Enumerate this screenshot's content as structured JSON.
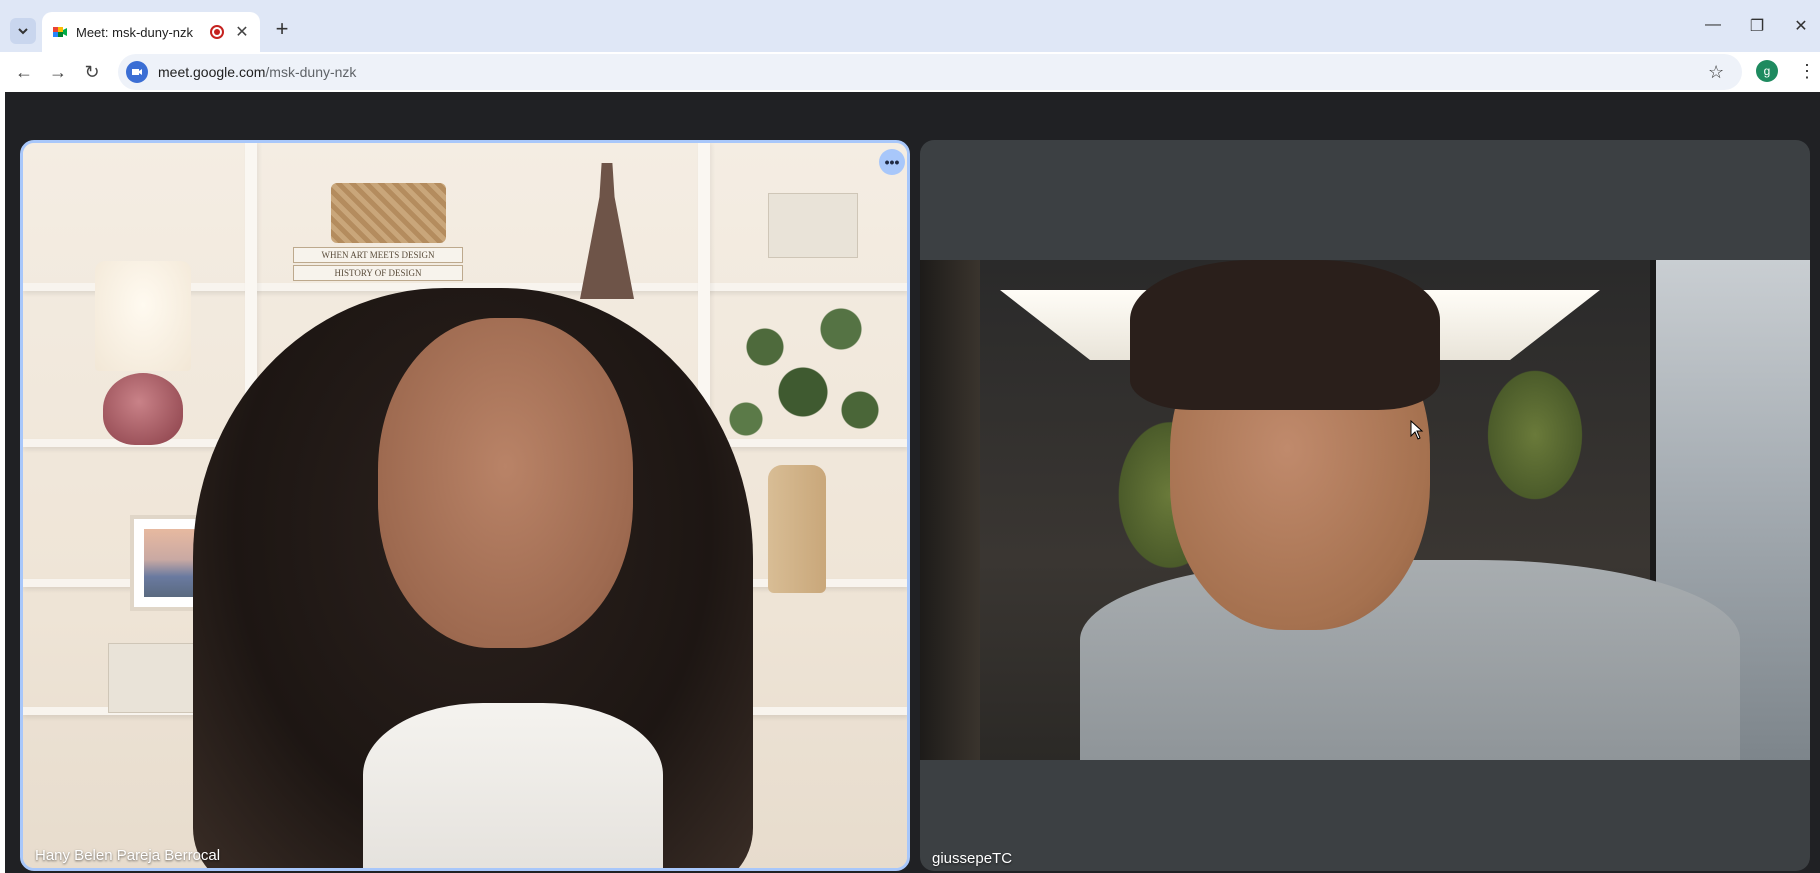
{
  "browser": {
    "tab": {
      "title": "Meet: msk-duny-nzk"
    },
    "url": {
      "host": "meet.google.com",
      "path": "/msk-duny-nzk"
    },
    "profile_initial": "g"
  },
  "meet": {
    "participants": [
      {
        "name": "Hany Belen Pareja Berrocal"
      },
      {
        "name": "giussepeTC"
      }
    ],
    "shelf_book_spines": [
      "WHEN ART MEETS DESIGN",
      "HISTORY OF DESIGN"
    ]
  },
  "colors": {
    "meet_bg": "#202124",
    "active_speaker_border": "#a8c7fa",
    "tile_bg": "#3c4043",
    "recording": "#c5221f"
  },
  "icons": [
    "tab-search-icon",
    "meet-favicon",
    "recording-icon",
    "close-icon",
    "plus-icon",
    "minimize-icon",
    "restore-icon",
    "close-window-icon",
    "back-icon",
    "forward-icon",
    "reload-icon",
    "meet-site-icon",
    "star-icon",
    "kebab-menu-icon",
    "more-options-icon"
  ]
}
